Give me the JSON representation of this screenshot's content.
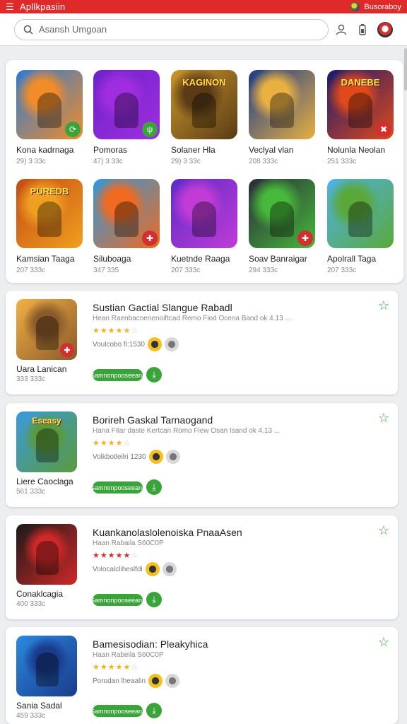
{
  "appbar": {
    "title": "Apllkpasiin",
    "right_label": "Busoraboy"
  },
  "search": {
    "placeholder": "Asansh Umgoan"
  },
  "grid": [
    {
      "name": "Kona kadrnaga",
      "meta": "29) 3 33c",
      "badge": "⟳",
      "badge_color": "#3aa43a",
      "colors": [
        "#2b7bd6",
        "#f28c28"
      ],
      "label": ""
    },
    {
      "name": "Pomoras",
      "meta": "47) 3 33c",
      "badge": "ψ",
      "badge_color": "#3aa43a",
      "colors": [
        "#6b22c8",
        "#a02ee0"
      ],
      "label": ""
    },
    {
      "name": "Solaner Hla",
      "meta": "29) 3 33c",
      "badge": "",
      "badge_color": "",
      "colors": [
        "#c9962a",
        "#5a3b16"
      ],
      "label": "KAGINON"
    },
    {
      "name": "Veclyal vlan",
      "meta": "208 333c",
      "badge": "",
      "badge_color": "",
      "colors": [
        "#1a3a8c",
        "#e8b040"
      ],
      "label": ""
    },
    {
      "name": "Nolunla Neolan",
      "meta": "251 333c",
      "badge": "✖",
      "badge_color": "#d32f2f",
      "colors": [
        "#1a1a6e",
        "#e04a1a"
      ],
      "label": "DANEBE"
    },
    {
      "name": "Kamsian Taaga",
      "meta": "207 333c",
      "badge": "",
      "badge_color": "",
      "colors": [
        "#c44a12",
        "#f0a020"
      ],
      "label": "PUREDB"
    },
    {
      "name": "Siluboaga",
      "meta": "347 335",
      "badge": "✚",
      "badge_color": "#d32f2f",
      "colors": [
        "#2a9ae0",
        "#f06a20"
      ],
      "label": ""
    },
    {
      "name": "Kuetnde Raaga",
      "meta": "207 333c",
      "badge": "",
      "badge_color": "",
      "colors": [
        "#5a2bc8",
        "#c23bd6"
      ],
      "label": ""
    },
    {
      "name": "Soav Banraigar",
      "meta": "294 333c",
      "badge": "✚",
      "badge_color": "#d32f2f",
      "colors": [
        "#2a2a3a",
        "#46b83a"
      ],
      "label": ""
    },
    {
      "name": "Apolrall Taga",
      "meta": "207 333c",
      "badge": "",
      "badge_color": "",
      "colors": [
        "#4fb2e8",
        "#5aa83a"
      ],
      "label": ""
    }
  ],
  "list": [
    {
      "title": "Sustian Gactial Slangue Rabadl",
      "sub": "Hean Raenbacnenenoiftcad Remo Fiod Ocena Band ok 4.13 ...",
      "stars_on": "★★★★★",
      "stars_off": "☆",
      "info": "Voulcobo fi:1530",
      "name": "Uara Lanican",
      "meta": "333 333c",
      "cta": "Gamnonpooseeana",
      "badge": "✚",
      "badge_color": "#d32f2f",
      "colors": [
        "#f2b045",
        "#8a5a2a"
      ],
      "label": "",
      "star_color": "#f2b01e"
    },
    {
      "title": "Borireh Gaskal Tarnaogand",
      "sub": "Hana Fitar daste Kertcan Romo Fiew Osan Isand ok 4.13 ...",
      "stars_on": "★★★★",
      "stars_off": "☆",
      "info": "Volkbotleilri 1230",
      "name": "Liere Caoclaga",
      "meta": "561 333c",
      "cta": "Gamnonpooseeana",
      "badge": "",
      "badge_color": "",
      "colors": [
        "#3a9ae0",
        "#5a9a3a"
      ],
      "label": "Eseasy",
      "star_color": "#f2b01e"
    },
    {
      "title": "Kuankanolaslolenoiska PnaaAsen",
      "sub": "Haan Rabaila S60C0P",
      "stars_on": "★★★★★",
      "stars_off": "☆",
      "info": "Volocalcliheslfdi",
      "name": "Conaklcagia",
      "meta": "400 333c",
      "cta": "Gamnonpooseeana",
      "badge": "",
      "badge_color": "",
      "colors": [
        "#1a1a1a",
        "#d02828"
      ],
      "label": "",
      "star_color": "#d32f2f"
    },
    {
      "title": "Bamesisodian: Pleakyhica",
      "sub": "Haan Rabeila S60C0P",
      "stars_on": "★★★★★",
      "stars_off": "☆",
      "info": "Porodan lheaalin",
      "name": "Sania Sadal",
      "meta": "459 333c",
      "cta": "Gamnonpooseeana",
      "badge": "",
      "badge_color": "",
      "colors": [
        "#2a8ae0",
        "#1a3a8c"
      ],
      "label": "",
      "star_color": "#f2b01e"
    }
  ]
}
